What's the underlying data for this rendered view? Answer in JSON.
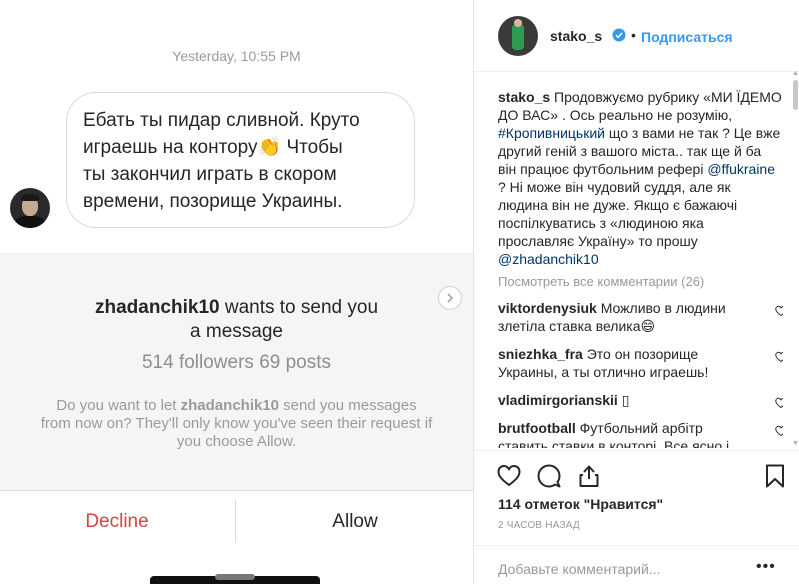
{
  "dm": {
    "timestamp": "Yesterday, 10:55 PM",
    "message_line1": "Ебать ты пидар сливной. Круто",
    "message_line2": "играешь на контору",
    "message_emoji": "👏",
    "message_line2_end": " Чтобы",
    "message_line3": "ты закончил играть в скором",
    "message_line4": "времени, позорище Украины."
  },
  "request": {
    "username": "zhadanchik10",
    "title_rest": " wants to send you",
    "title_line2": "a message",
    "stats": "514 followers 69 posts",
    "desc_pre": "Do you want to let ",
    "desc_user": "zhadanchik10",
    "desc_post": " send you messages from now on? They'll only know you've seen their request if you choose Allow.",
    "decline_label": "Decline",
    "allow_label": "Allow"
  },
  "post": {
    "username": "stako_s",
    "dot": "•",
    "follow_label": "Подписаться",
    "caption_user": "stako_s",
    "caption_part1": " Продовжуємо рубрику «МИ ЇДЕМО ДО ВАС» . Ось реально не розумію, ",
    "caption_tag": "#Кропивницький",
    "caption_part2": " що з вами не так ? Це вже другий геній з вашого міста.. так ще й ба він працює футбольним рефері ",
    "caption_mention1": "@ffukraine",
    "caption_part3": " ? Ні може він чудовий суддя, але як людина він не дуже. Якщо є бажаючі поспілкуватись з «людиною яка прославляє Україну» то прошу ",
    "caption_mention2": "@zhadanchik10",
    "more_comments": "Посмотреть все комментарии (26)",
    "comments": [
      {
        "user": "viktordenysiuk",
        "text": " Можливо в людини злетіла ставка велика😄"
      },
      {
        "user": "sniezhka_fra",
        "text": " Это он позорище Украины, а ты отлично играешь!"
      },
      {
        "user": "vladimirgorianskii",
        "text": " ▯"
      },
      {
        "user": "brutfootball",
        "text": " Футбольний арбітр ставить ставки в конторі. Все ясно і безкарно..."
      }
    ],
    "likes": "114 отметок \"Нравится\"",
    "time_ago": "2 ЧАСОВ НАЗАД",
    "add_comment_placeholder": "Добавьте комментарий...",
    "more_options": "•••"
  },
  "colors": {
    "accent": "#3897f0",
    "decline": "#d04545",
    "text": "#262626",
    "muted": "#8e8e8e"
  },
  "icons": [
    "chevron-right-icon",
    "verified-badge-icon",
    "heart-icon",
    "comment-icon",
    "share-icon",
    "bookmark-icon"
  ]
}
